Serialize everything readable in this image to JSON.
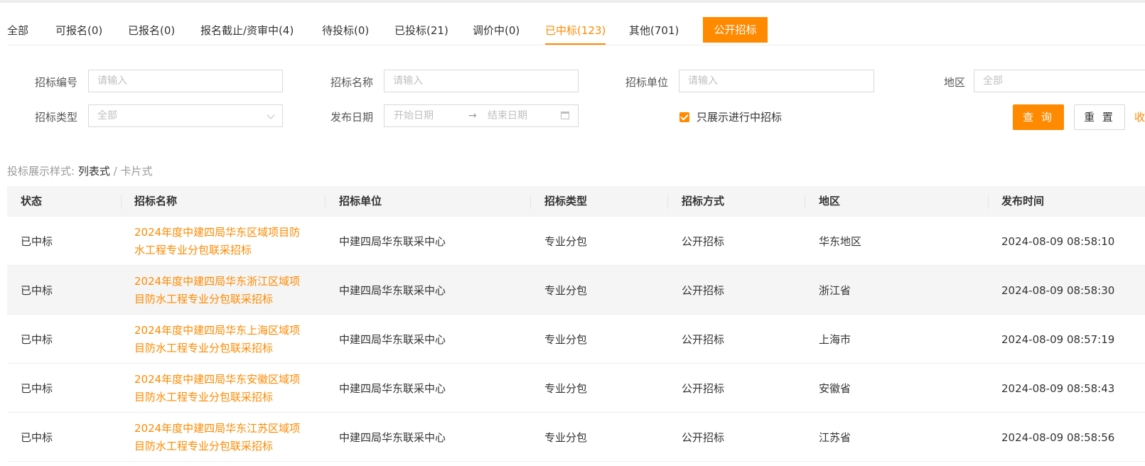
{
  "tabs": [
    {
      "label": "全部",
      "active": false
    },
    {
      "label": "可报名(0)",
      "active": false
    },
    {
      "label": "已报名(0)",
      "active": false
    },
    {
      "label": "报名截止/资审中(4)",
      "active": false
    },
    {
      "label": "待投标(0)",
      "active": false
    },
    {
      "label": "已投标(21)",
      "active": false
    },
    {
      "label": "调价中(0)",
      "active": false
    },
    {
      "label": "已中标(123)",
      "active": true
    },
    {
      "label": "其他(701)",
      "active": false
    }
  ],
  "public_tab": "公开招标",
  "filters": {
    "bid_no": {
      "label": "招标编号",
      "placeholder": "请输入"
    },
    "bid_name": {
      "label": "招标名称",
      "placeholder": "请输入"
    },
    "bid_unit": {
      "label": "招标单位",
      "placeholder": "请输入"
    },
    "region": {
      "label": "地区",
      "value": "全部"
    },
    "bid_type": {
      "label": "招标类型",
      "value": "全部"
    },
    "publish_date": {
      "label": "发布日期",
      "start": "开始日期",
      "end": "结束日期"
    },
    "only_active": {
      "label": "只展示进行中招标",
      "checked": true
    },
    "query": "查 询",
    "reset": "重 置",
    "collapse": "收"
  },
  "view_style": {
    "label": "投标展示样式:",
    "current": "列表式",
    "separator": " / ",
    "other": "卡片式"
  },
  "table": {
    "headers": [
      "状态",
      "招标名称",
      "招标单位",
      "招标类型",
      "招标方式",
      "地区",
      "发布时间"
    ],
    "rows": [
      {
        "status": "已中标",
        "name": "2024年度中建四局华东区域项目防水工程专业分包联采招标",
        "unit": "中建四局华东联采中心",
        "type": "专业分包",
        "method": "公开招标",
        "region": "华东地区",
        "time": "2024-08-09 08:58:10"
      },
      {
        "status": "已中标",
        "name": "2024年度中建四局华东浙江区域项目防水工程专业分包联采招标",
        "unit": "中建四局华东联采中心",
        "type": "专业分包",
        "method": "公开招标",
        "region": "浙江省",
        "time": "2024-08-09 08:58:30"
      },
      {
        "status": "已中标",
        "name": "2024年度中建四局华东上海区域项目防水工程专业分包联采招标",
        "unit": "中建四局华东联采中心",
        "type": "专业分包",
        "method": "公开招标",
        "region": "上海市",
        "time": "2024-08-09 08:57:19"
      },
      {
        "status": "已中标",
        "name": "2024年度中建四局华东安徽区域项目防水工程专业分包联采招标",
        "unit": "中建四局华东联采中心",
        "type": "专业分包",
        "method": "公开招标",
        "region": "安徽省",
        "time": "2024-08-09 08:58:43"
      },
      {
        "status": "已中标",
        "name": "2024年度中建四局华东江苏区域项目防水工程专业分包联采招标",
        "unit": "中建四局华东联采中心",
        "type": "专业分包",
        "method": "公开招标",
        "region": "江苏省",
        "time": "2024-08-09 08:58:56"
      }
    ]
  },
  "colors": {
    "accent": "#ff8a00",
    "header_bg": "#f5f5f5",
    "stripe_bg": "#f5f5f5"
  }
}
